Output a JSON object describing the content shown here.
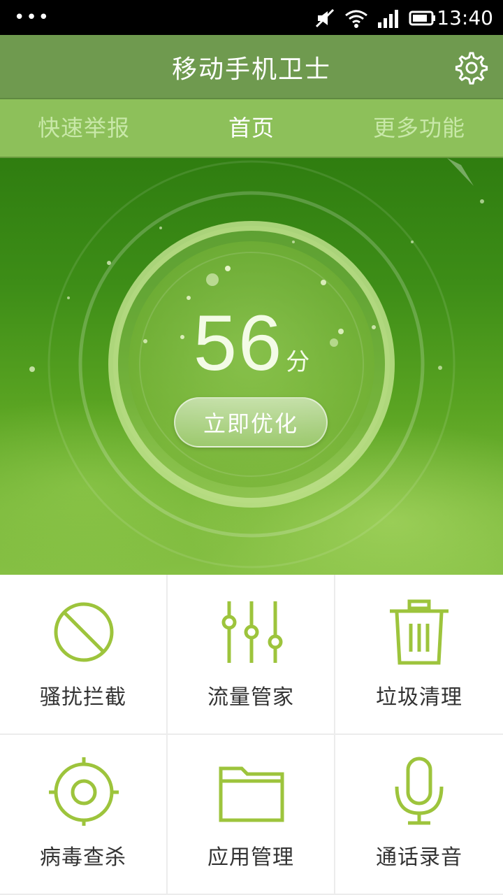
{
  "status_bar": {
    "dots": "•••",
    "time": "13:40"
  },
  "app": {
    "title": "移动手机卫士",
    "settings_icon": "gear-icon"
  },
  "tabs": [
    {
      "label": "快速举报",
      "active": false
    },
    {
      "label": "首页",
      "active": true
    },
    {
      "label": "更多功能",
      "active": false
    }
  ],
  "hero": {
    "score": "56",
    "score_unit": "分",
    "optimize_label": "立即优化"
  },
  "features": [
    {
      "label": "骚扰拦截",
      "icon": "block-icon"
    },
    {
      "label": "流量管家",
      "icon": "sliders-icon"
    },
    {
      "label": "垃圾清理",
      "icon": "trash-icon"
    },
    {
      "label": "病毒查杀",
      "icon": "target-icon"
    },
    {
      "label": "应用管理",
      "icon": "folder-icon"
    },
    {
      "label": "通话录音",
      "icon": "microphone-icon"
    }
  ],
  "colors": {
    "accent": "#9dc43c",
    "header": "#6f9a4f",
    "tabs": "#8dc05a"
  }
}
